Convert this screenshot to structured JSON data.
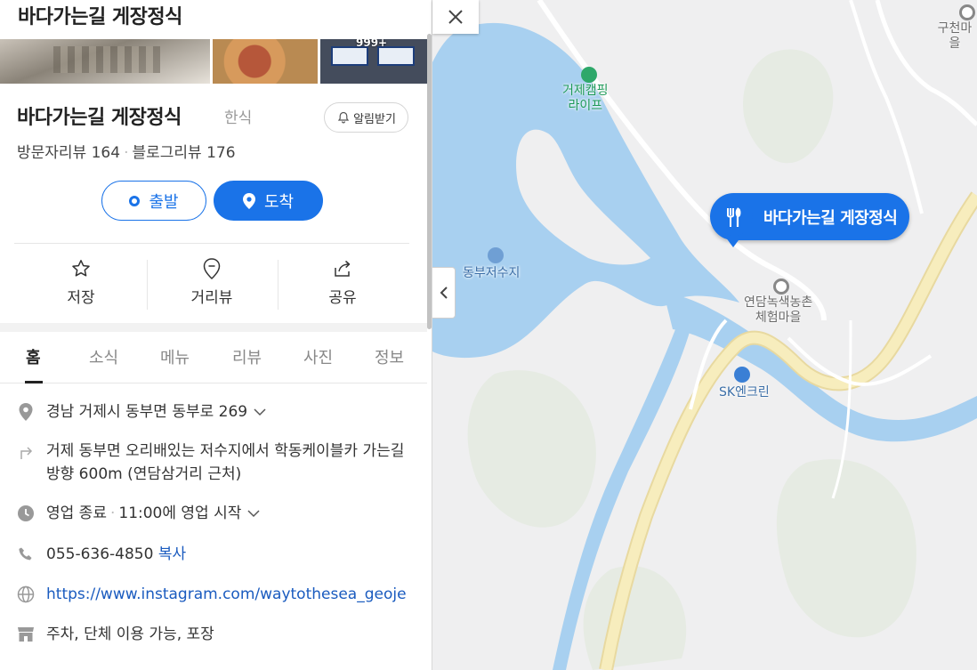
{
  "header": {
    "title": "바다가는길 게장정식"
  },
  "photos": {
    "count_badge": "999+"
  },
  "place": {
    "name": "바다가는길 게장정식",
    "category": "한식",
    "alert_label": "알림받기",
    "visitor_reviews": "방문자리뷰 164",
    "blog_reviews": "블로그리뷰 176"
  },
  "route": {
    "start_label": "출발",
    "end_label": "도착"
  },
  "actions": {
    "save": "저장",
    "streetview": "거리뷰",
    "share": "공유"
  },
  "tabs": [
    "홈",
    "소식",
    "메뉴",
    "리뷰",
    "사진",
    "정보"
  ],
  "info": {
    "address": "경남 거제시 동부면 동부로 269",
    "directions": "거제 동부면 오리배있는 저수지에서 학동케이블카 가는길 방향 600m (연담삼거리 근처)",
    "hours_status": "영업 종료",
    "hours_detail": "11:00에 영업 시작",
    "phone": "055-636-4850",
    "copy_label": "복사",
    "website": "https://www.instagram.com/waytothesea_geoje",
    "facilities": "주차, 단체 이용 가능, 포장"
  },
  "map": {
    "labels": {
      "camping": "거제캠핑\n라이프",
      "reservoir": "동부저수지",
      "village": "연담녹색농촌\n체험마을",
      "gas": "SK엔크린",
      "gucheon": "구천마을"
    },
    "pin_label": "바다가는길 게장정식"
  },
  "colors": {
    "accent": "#1a73e8",
    "water": "#a8d0f0",
    "road": "#f3e6a6"
  }
}
